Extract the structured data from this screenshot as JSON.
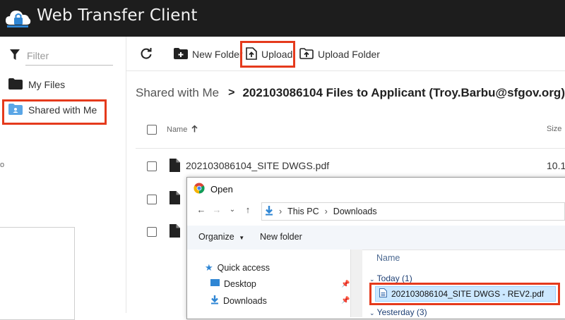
{
  "app": {
    "title": "Web Transfer Client"
  },
  "sidebar": {
    "filter_placeholder": "Filter",
    "items": [
      {
        "label": "My Files",
        "icon": "folder-icon"
      },
      {
        "label": "Shared with Me",
        "icon": "shared-folder-icon"
      }
    ]
  },
  "toolbar": {
    "refresh_icon": "refresh-icon",
    "new_folder_label": "New Folder",
    "upload_label": "Upload",
    "upload_folder_label": "Upload Folder"
  },
  "breadcrumb": {
    "parent": "Shared with Me",
    "separator": ">",
    "current": "202103086104 Files to Applicant (Troy.Barbu@sfgov.org)"
  },
  "table": {
    "columns": [
      {
        "label": "Name",
        "sort": "ascending"
      },
      {
        "label": "Size"
      }
    ],
    "rows": [
      {
        "name": "202103086104_SITE DWGS.pdf",
        "size": "10.1"
      },
      {
        "name": "",
        "size": ""
      },
      {
        "name": "",
        "size": ""
      }
    ]
  },
  "open_dialog": {
    "title": "Open",
    "address": [
      "This PC",
      "Downloads"
    ],
    "organize_label": "Organize",
    "new_folder_label": "New folder",
    "nav": [
      {
        "label": "Quick access",
        "icon": "star-icon"
      },
      {
        "label": "Desktop",
        "icon": "desktop-icon"
      },
      {
        "label": "Downloads",
        "icon": "download-icon"
      }
    ],
    "column_name": "Name",
    "groups": [
      {
        "label": "Today (1)",
        "files": [
          "202103086104_SITE DWGS - REV2.pdf"
        ]
      },
      {
        "label": "Yesterday (3)"
      }
    ]
  },
  "colors": {
    "header_bg": "#1d1d1d",
    "highlight": "#e53a1c",
    "selection": "#cce8ff",
    "accent_blue": "#2f86d4"
  }
}
